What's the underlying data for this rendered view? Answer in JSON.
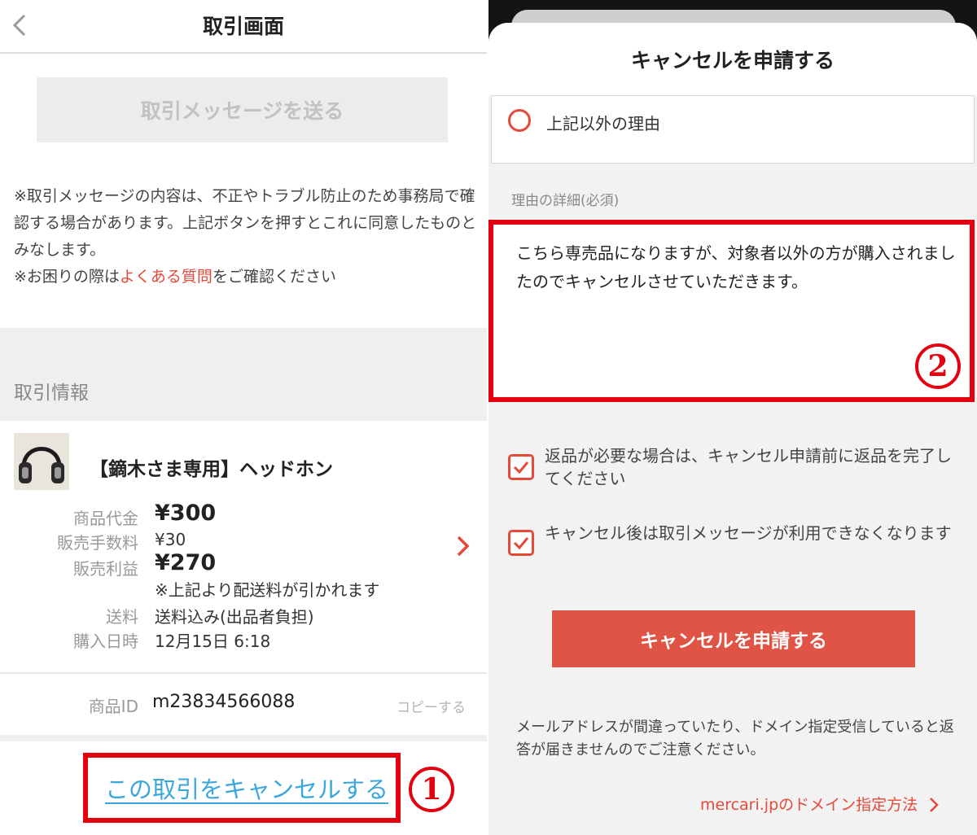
{
  "left": {
    "header_title": "取引画面",
    "send_button_label": "取引メッセージを送る",
    "notice_line1": "※取引メッセージの内容は、不正やトラブル防止のため事務局で確認する場合があります。上記ボタンを押すとこれに同意したものとみなします。",
    "notice_line2_pre": "※お困りの際は",
    "notice_line2_link": "よくある質問",
    "notice_line2_post": "をご確認ください",
    "section_title": "取引情報",
    "item_title": "【鏑木さま専用】ヘッドホン",
    "rows": {
      "price_label": "商品代金",
      "price_value": "¥300",
      "fee_label": "販売手数料",
      "fee_value": "¥30",
      "profit_label": "販売利益",
      "profit_value": "¥270",
      "profit_note": "※上記より配送料が引かれます",
      "shipping_label": "送料",
      "shipping_value": "送料込み(出品者負担)",
      "date_label": "購入日時",
      "date_value": "12月15日 6:18"
    },
    "id_label": "商品ID",
    "id_value": "m23834566088",
    "copy_label": "コピーする",
    "cancel_link": "この取引をキャンセルする",
    "annotation_num": "1"
  },
  "right": {
    "sheet_title": "キャンセルを申請する",
    "reason_option": "上記以外の理由",
    "detail_label": "理由の詳細(必須)",
    "detail_text": "こちら専売品になりますが、対象者以外の方が購入されましたのでキャンセルさせていただきます。",
    "annotation_num": "2",
    "check1": "返品が必要な場合は、キャンセル申請前に返品を完了してください",
    "check2": "キャンセル後は取引メッセージが利用できなくなります",
    "submit_label": "キャンセルを申請する",
    "mail_note": "メールアドレスが間違っていたり、ドメイン指定受信していると返答が届きませんのでご注意ください。",
    "domain_link": "mercari.jpのドメイン指定方法"
  },
  "colors": {
    "accent_red": "#e5493a",
    "highlight_red": "#e3000f",
    "link_blue": "#3aa6dc",
    "submit_red": "#e05446"
  }
}
